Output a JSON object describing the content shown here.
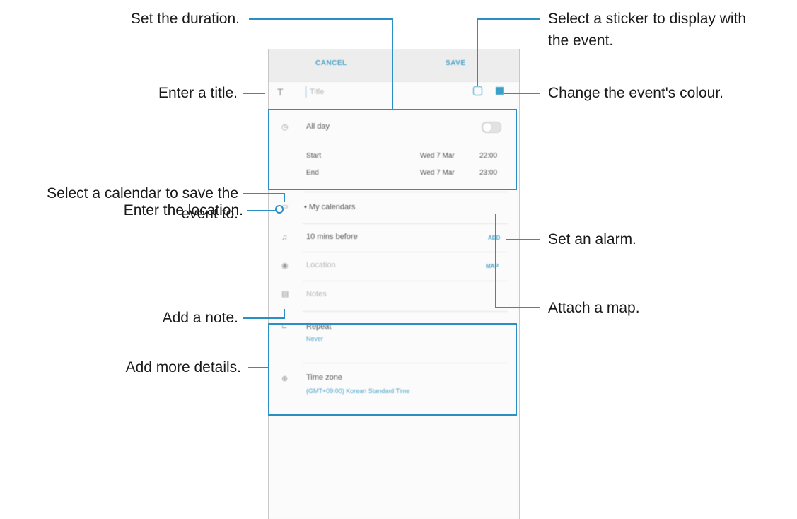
{
  "callouts": {
    "duration": "Set the duration.",
    "title": "Enter a title.",
    "calendar_line1": "Select a calendar to save the",
    "calendar_line2": "event to.",
    "location": "Enter the location.",
    "note": "Add a note.",
    "details": "Add more details.",
    "sticker_line1": "Select a sticker to display with",
    "sticker_line2": "the event.",
    "colour": "Change the event's colour.",
    "alarm": "Set an alarm.",
    "map": "Attach a map."
  },
  "topbar": {
    "cancel": "CANCEL",
    "save": "SAVE"
  },
  "form": {
    "title_placeholder": "Title",
    "all_day": "All day",
    "start_label": "Start",
    "start_date": "Wed 7 Mar",
    "start_time": "22:00",
    "end_label": "End",
    "end_date": "Wed 7 Mar",
    "end_time": "23:00",
    "calendar": "• My calendars",
    "alarm": "10 mins before",
    "add": "ADD",
    "location_placeholder": "Location",
    "map": "MAP",
    "notes_placeholder": "Notes",
    "repeat_label": "Repeat",
    "repeat_value": "Never",
    "timezone_label": "Time zone",
    "timezone_value": "(GMT+09:00) Korean Standard Time"
  },
  "colors": {
    "accent": "#2a8fc4",
    "event_colour": "#3aa0c8"
  },
  "icons": [
    "title-icon",
    "clock-icon",
    "calendar-icon",
    "bell-icon",
    "location-pin-icon",
    "note-icon",
    "repeat-icon",
    "globe-icon",
    "sticker-icon"
  ]
}
